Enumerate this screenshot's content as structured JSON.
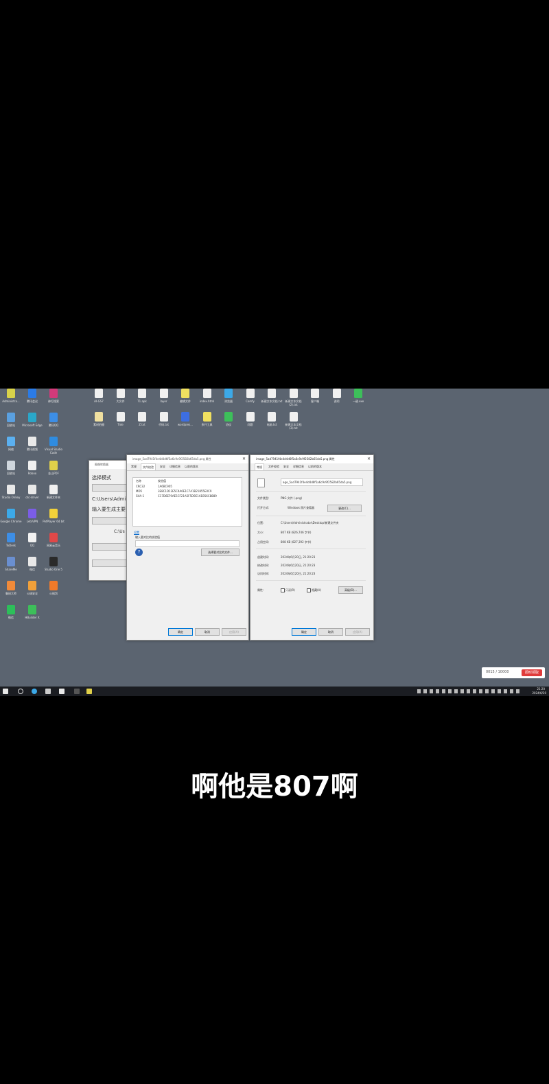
{
  "desktop_icons": [
    {
      "label": "Administra...",
      "color": "#d8d24a"
    },
    {
      "label": "腾讯会议",
      "color": "#2b7be6"
    },
    {
      "label": "神灯搜索",
      "color": "#d23a7a"
    },
    {
      "label": "回收站",
      "color": "#5aa0e0"
    },
    {
      "label": "Microsoft Edge",
      "color": "#2aa7c9"
    },
    {
      "label": "腾讯QQ",
      "color": "#3d8ee6"
    },
    {
      "label": "网络",
      "color": "#5bb0f0"
    },
    {
      "label": "腾讯视频",
      "color": "#e9e9e9"
    },
    {
      "label": "Visual Studio Code",
      "color": "#2f8ce0"
    },
    {
      "label": "回收站",
      "color": "#cfd6dd"
    },
    {
      "label": "Roboo",
      "color": "#f0f0f0"
    },
    {
      "label": "金山PDF",
      "color": "#e0d04a"
    },
    {
      "label": "Studio Onkey",
      "color": "#e8e8e8"
    },
    {
      "label": "otc-driver",
      "color": "#e8e8e8"
    },
    {
      "label": "新建文件夹",
      "color": "#f0f0f0"
    },
    {
      "label": "Google Chrome",
      "color": "#3ca9e8"
    },
    {
      "label": "LetsVPN",
      "color": "#7b5de6"
    },
    {
      "label": "PotPlayer 64 bit",
      "color": "#f2d23a"
    },
    {
      "label": "ToDesk",
      "color": "#3d8ee6"
    },
    {
      "label": "QQ",
      "color": "#f2f2f2"
    },
    {
      "label": "网易云音乐",
      "color": "#e04848"
    },
    {
      "label": "ShareMe",
      "color": "#6a8fd0"
    },
    {
      "label": "微信",
      "color": "#e8e8e8"
    },
    {
      "label": "Studio One 5",
      "color": "#2a2a2a"
    },
    {
      "label": "鲁班大师",
      "color": "#f08a3a"
    },
    {
      "label": "火绒安全",
      "color": "#f0a03a"
    },
    {
      "label": "火绒剑",
      "color": "#f07a2a"
    },
    {
      "label": "微信",
      "color": "#2dbf5a"
    },
    {
      "label": "HBuilder X",
      "color": "#3dbf5a"
    }
  ],
  "desktop_icons_top": [
    {
      "label": "AI-GS7",
      "color": "#f0f0f0"
    },
    {
      "label": "大文件",
      "color": "#f0f0f0"
    },
    {
      "label": "T1.apk",
      "color": "#f0f0f0"
    },
    {
      "label": "layer",
      "color": "#f0f0f0"
    },
    {
      "label": "编辑文件",
      "color": "#f0e060"
    },
    {
      "label": "index.html",
      "color": "#f0f0f0"
    },
    {
      "label": "浏览器",
      "color": "#3ca9e8"
    },
    {
      "label": "Comfy",
      "color": "#f0f0f0"
    },
    {
      "label": "新建文本文档.txt",
      "color": "#f0f0f0"
    },
    {
      "label": "新建文本文档(2).txt",
      "color": "#f0f0f0"
    },
    {
      "label": "客户端",
      "color": "#f0f0f0"
    },
    {
      "label": "说明",
      "color": "#f0f0f0"
    },
    {
      "label": "一键.exe",
      "color": "#3dbf5a"
    }
  ],
  "desktop_icons_row2": [
    {
      "label": "素材拍摄",
      "color": "#f0e0a0"
    },
    {
      "label": "Tide",
      "color": "#f0f0f0"
    },
    {
      "label": "Z.txt",
      "color": "#f0f0f0"
    },
    {
      "label": "代码.txt",
      "color": "#f0f0f0"
    },
    {
      "label": "wordpres...",
      "color": "#3d6ee0"
    },
    {
      "label": "多开工具",
      "color": "#f0e060"
    },
    {
      "label": "协议",
      "color": "#3dbf5a"
    },
    {
      "label": "问题",
      "color": "#f0f0f0"
    },
    {
      "label": "电脑.txt",
      "color": "#f0f0f0"
    },
    {
      "label": "新建文本文档(3).txt",
      "color": "#f0f0f0"
    }
  ],
  "bg_dialog": {
    "title": "图像转换器",
    "line1": "选择模式",
    "line2": "C:\\Users\\Adminis",
    "line3": "输入要生成主要",
    "line4": "C:\\Us"
  },
  "props1": {
    "title": "image_5ad7941f4e4d4d6f5a6c9c9f2582b65da5.png 属性",
    "tabs": [
      "常规",
      "文件校验",
      "安全",
      "详细信息",
      "以前的版本"
    ],
    "hash_header": [
      "名称",
      "校验值"
    ],
    "hashes": [
      [
        "CRC32",
        "1A6BC905"
      ],
      [
        "MD5",
        "3E8C1D12E5C4A6E1C7A1B21855E0C9"
      ],
      [
        "SHA-1",
        "C17D6EF9AE5CF21A5F5D9E1A1B56C8889"
      ]
    ],
    "link": "设置",
    "input_label": "输入要对比的校验值",
    "compare_btn": "选择要对比的文件...",
    "ok": "确定",
    "cancel": "取消",
    "apply": "应用(A)"
  },
  "props2": {
    "title": "image_5ad7941f4e4d4d6f5a6c9c9f2582b65da5.png 属性",
    "tabs": [
      "常规",
      "文件校验",
      "安全",
      "详细信息",
      "以前的版本"
    ],
    "filename": "age_5ad7941f4e4d4d6f5a6c9c9f2582b65da5.png",
    "type_label": "文件类型:",
    "type_value": "PNG 文件 (.png)",
    "open_label": "打开方式:",
    "open_value": "Windows 照片查看器",
    "change_btn": "更改(C)...",
    "loc_label": "位置:",
    "loc_value": "C:\\Users\\Administrator\\Desktop\\新建文件夹",
    "size_label": "大小:",
    "size_value": "807 KB (826,746 字节)",
    "disk_label": "占用空间:",
    "disk_value": "808 KB (827,392 字节)",
    "created_label": "创建时间:",
    "created_value": "2024年6月20日, 21:20:23",
    "modified_label": "修改时间:",
    "modified_value": "2024年6月20日, 21:20:23",
    "accessed_label": "访问时间:",
    "accessed_value": "2024年6月20日, 21:20:23",
    "attr_label": "属性:",
    "readonly": "只读(R)",
    "hidden": "隐藏(H)",
    "advanced_btn": "高级(D)...",
    "ok": "确定",
    "cancel": "取消",
    "apply": "应用(A)"
  },
  "overlay": {
    "counter": "0015 / 10000",
    "button": "即时领取"
  },
  "taskbar": {
    "time": "21:20",
    "date": "2024/6/20"
  },
  "subtitle": "啊他是807啊"
}
